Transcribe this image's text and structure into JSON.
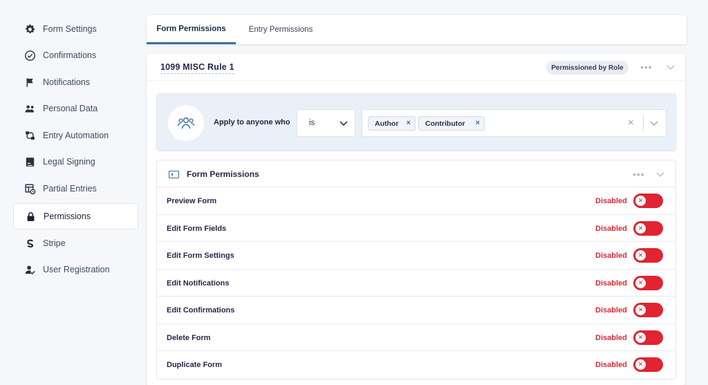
{
  "sidebar": {
    "items": [
      {
        "label": "Form Settings",
        "icon": "gear-icon"
      },
      {
        "label": "Confirmations",
        "icon": "check-circle-icon"
      },
      {
        "label": "Notifications",
        "icon": "flag-icon"
      },
      {
        "label": "Personal Data",
        "icon": "users-icon"
      },
      {
        "label": "Entry Automation",
        "icon": "automation-icon"
      },
      {
        "label": "Legal Signing",
        "icon": "document-sign-icon"
      },
      {
        "label": "Partial Entries",
        "icon": "partial-entries-icon"
      },
      {
        "label": "Permissions",
        "icon": "lock-icon",
        "active": true
      },
      {
        "label": "Stripe",
        "icon": "stripe-icon"
      },
      {
        "label": "User Registration",
        "icon": "user-check-icon"
      }
    ]
  },
  "tabs": [
    {
      "label": "Form Permissions",
      "active": true
    },
    {
      "label": "Entry Permissions"
    }
  ],
  "rule": {
    "title": "1099 MISC Rule 1",
    "badge": "Permissioned by Role",
    "condition": {
      "label": "Apply to anyone who",
      "operator": "is",
      "values": [
        "Author",
        "Contributor"
      ]
    }
  },
  "permissions": {
    "title": "Form Permissions",
    "rows": [
      {
        "label": "Preview Form",
        "status": "Disabled"
      },
      {
        "label": "Edit Form Fields",
        "status": "Disabled"
      },
      {
        "label": "Edit Form Settings",
        "status": "Disabled"
      },
      {
        "label": "Edit Notifications",
        "status": "Disabled"
      },
      {
        "label": "Edit Confirmations",
        "status": "Disabled"
      },
      {
        "label": "Delete Form",
        "status": "Disabled"
      },
      {
        "label": "Duplicate Form",
        "status": "Disabled"
      }
    ]
  },
  "colors": {
    "accent": "#3a6ea5",
    "disabled": "#e02431",
    "background": "#f5f7fa"
  }
}
